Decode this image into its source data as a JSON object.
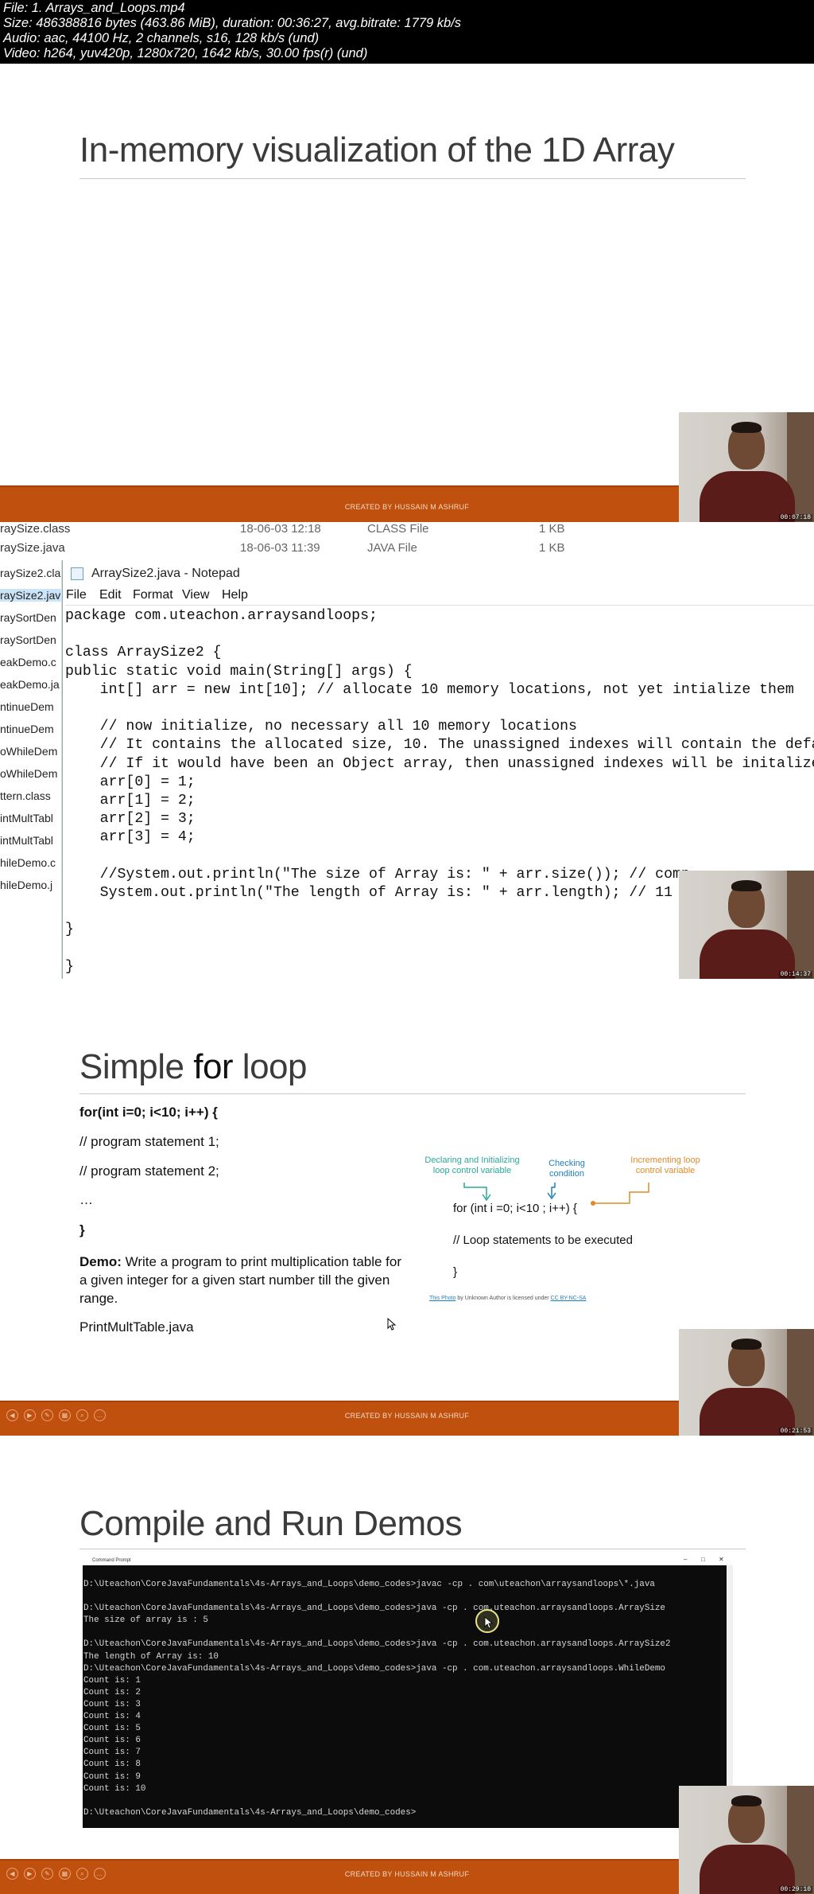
{
  "header": {
    "file": "File: 1. Arrays_and_Loops.mp4",
    "size": "Size: 486388816 bytes (463.86 MiB), duration: 00:36:27, avg.bitrate: 1779 kb/s",
    "audio": "Audio: aac, 44100 Hz, 2 channels, s16, 128 kb/s (und)",
    "video": "Video: h264, yuv420p, 1280x720, 1642 kb/s, 30.00 fps(r) (und)"
  },
  "frame1": {
    "title": "In-memory visualization of the 1D Array",
    "footer": "CREATED BY HUSSAIN M ASHRUF",
    "timestamp": "00:07:18"
  },
  "frame2": {
    "explorer_rows": [
      {
        "name": "raySize.class",
        "date": "18-06-03 12:18",
        "type": "CLASS File",
        "size": "1 KB"
      },
      {
        "name": "raySize.java",
        "date": "18-06-03 11:39",
        "type": "JAVA File",
        "size": "1 KB"
      }
    ],
    "side_items": [
      "raySize2.cla",
      "raySize2.jav",
      "raySortDen",
      "raySortDen",
      "eakDemo.c",
      "eakDemo.ja",
      "ntinueDem",
      "ntinueDem",
      "oWhileDem",
      "oWhileDem",
      "ttern.class",
      "intMultTabl",
      "intMultTabl",
      "hileDemo.c",
      "hileDemo.j"
    ],
    "window_title": "ArraySize2.java - Notepad",
    "menu": [
      "File",
      "Edit",
      "Format",
      "View",
      "Help"
    ],
    "code": "package com.uteachon.arraysandloops;\n\nclass ArraySize2 {\npublic static void main(String[] args) {\n    int[] arr = new int[10]; // allocate 10 memory locations, not yet intialize them\n\n    // now initialize, no necessary all 10 memory locations\n    // It contains the allocated size, 10. The unassigned indexes will contain the defaul\n    // If it would have been an Object array, then unassigned indexes will be initalized\n    arr[0] = 1;\n    arr[1] = 2;\n    arr[2] = 3;\n    arr[3] = 4;\n\n    //System.out.println(\"The size of Array is: \" + arr.size()); // comp\n    System.out.println(\"The length of Array is: \" + arr.length); // 11\n\n}\n\n}",
    "timestamp": "00:14:37"
  },
  "frame3": {
    "title_pre": "Simple ",
    "title_bold": "for",
    "title_post": " loop",
    "lines": [
      "for(int i=0; i<10; i++) {",
      "// program statement 1;",
      "// program statement 2;",
      "…",
      "}"
    ],
    "demo_label": "Demo:",
    "demo_text": " Write a program to print multiplication table for a given integer for a given start number till the given range.",
    "file": "PrintMultTable.java",
    "diagram": {
      "label_init": "Declaring and Initializing\nloop control variable",
      "label_check": "Checking\ncondition",
      "label_incr": "Incrementing loop\ncontrol variable",
      "code_for": "for (int i =0; i<10 ; i++) {",
      "code_body": "// Loop statements to be executed",
      "code_close": "}",
      "credit_link": "This Photo",
      "credit_mid": " by Unknown Author is licensed under ",
      "credit_license": "CC BY-NC-SA",
      "color_init": "#2aa89a",
      "color_check": "#1f7fc0",
      "color_incr": "#e08a2a"
    },
    "footer": "CREATED BY HUSSAIN M ASHRUF",
    "timestamp": "00:21:53"
  },
  "frame4": {
    "title": "Compile and Run Demos",
    "term_title": "Command Prompt",
    "terminal": "D:\\Uteachon\\CoreJavaFundamentals\\4s-Arrays_and_Loops\\demo_codes>javac -cp . com\\uteachon\\arraysandloops\\*.java\n\nD:\\Uteachon\\CoreJavaFundamentals\\4s-Arrays_and_Loops\\demo_codes>java -cp . com.uteachon.arraysandloops.ArraySize\nThe size of array is : 5\n\nD:\\Uteachon\\CoreJavaFundamentals\\4s-Arrays_and_Loops\\demo_codes>java -cp . com.uteachon.arraysandloops.ArraySize2\nThe length of Array is: 10\nD:\\Uteachon\\CoreJavaFundamentals\\4s-Arrays_and_Loops\\demo_codes>java -cp . com.uteachon.arraysandloops.WhileDemo\nCount is: 1\nCount is: 2\nCount is: 3\nCount is: 4\nCount is: 5\nCount is: 6\nCount is: 7\nCount is: 8\nCount is: 9\nCount is: 10\n\nD:\\Uteachon\\CoreJavaFundamentals\\4s-Arrays_and_Loops\\demo_codes>",
    "footer": "CREATED BY HUSSAIN M ASHRUF",
    "timestamp": "00:29:10"
  }
}
